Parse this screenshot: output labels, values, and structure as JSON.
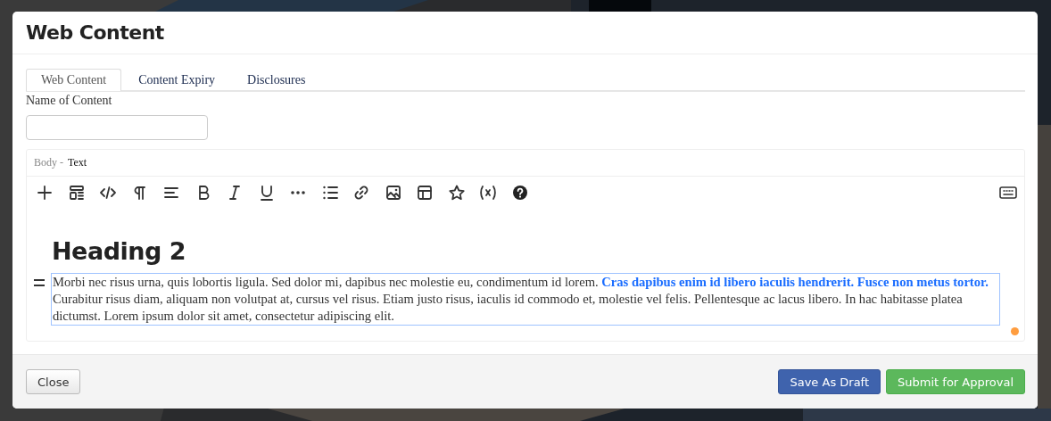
{
  "dialog": {
    "title": "Web Content"
  },
  "tabs": [
    {
      "label": "Web Content",
      "selected": true
    },
    {
      "label": "Content Expiry",
      "selected": false
    },
    {
      "label": "Disclosures",
      "selected": false
    }
  ],
  "name_field": {
    "label": "Name of Content"
  },
  "body_editor": {
    "label": "Body -",
    "type": "Text",
    "heading": "Heading 2",
    "paragraph": "Morbi nec risus urna, quis lobortis ligula. Sed dolor mi, dapibus nec molestie eu, condimentum id lorem. **Cras dapibus enim id libero iaculis hendrerit. Fusce non metus tortor.** Curabitur risus diam, aliquam non volutpat at, cursus vel risus. Etiam justo risus, iaculis id commodo et, molestie vel felis. Pellentesque ac lacus libero. In hac habitasse platea dictumst. Lorem ipsum dolor sit amet, consectetur adipiscing elit.",
    "indicators": [
      {
        "color": "#ff9d3f"
      }
    ]
  },
  "footer": {
    "buttons": [
      {
        "label": "Close",
        "kind": "default"
      },
      {
        "label": "Save As Draft",
        "kind": "primary"
      },
      {
        "label": "Submit for Approval",
        "kind": "success"
      }
    ]
  }
}
